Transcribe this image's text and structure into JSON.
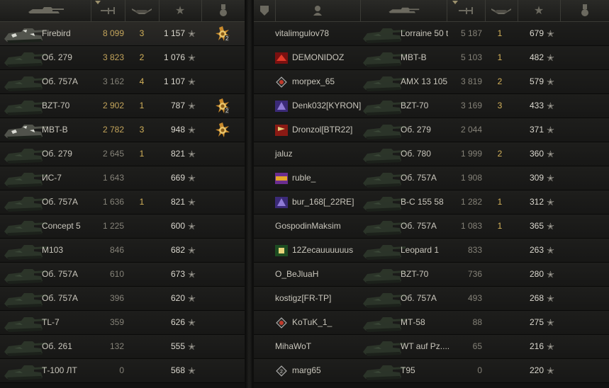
{
  "left_team": [
    {
      "tank": "Firebird",
      "battles": "8 099",
      "wins": "3",
      "score": "1 157",
      "medal": true,
      "medal_count": "2",
      "gold": true,
      "highlight": true
    },
    {
      "tank": "Об. 279",
      "battles": "3 823",
      "wins": "2",
      "score": "1 076",
      "gold": true
    },
    {
      "tank": "Об. 757А",
      "battles": "3 162",
      "wins": "4",
      "score": "1 107"
    },
    {
      "tank": "BZT-70",
      "battles": "2 902",
      "wins": "1",
      "score": "787",
      "medal": true,
      "medal_count": "2",
      "gold": true
    },
    {
      "tank": "MBT-B",
      "battles": "2 782",
      "wins": "3",
      "score": "948",
      "medal": true,
      "medal_count": "",
      "gold": true
    },
    {
      "tank": "Об. 279",
      "battles": "2 645",
      "wins": "1",
      "score": "821"
    },
    {
      "tank": "ИС-7",
      "battles": "1 643",
      "wins": "",
      "score": "669"
    },
    {
      "tank": "Об. 757А",
      "battles": "1 636",
      "wins": "1",
      "score": "821"
    },
    {
      "tank": "Concept 5",
      "battles": "1 225",
      "wins": "",
      "score": "600"
    },
    {
      "tank": "M103",
      "battles": "846",
      "wins": "",
      "score": "682"
    },
    {
      "tank": "Об. 757А",
      "battles": "610",
      "wins": "",
      "score": "673"
    },
    {
      "tank": "Об. 757А",
      "battles": "396",
      "wins": "",
      "score": "620"
    },
    {
      "tank": "TL-7",
      "battles": "359",
      "wins": "",
      "score": "626"
    },
    {
      "tank": "Об. 261",
      "battles": "132",
      "wins": "",
      "score": "555"
    },
    {
      "tank": "Т-100 ЛТ",
      "battles": "0",
      "wins": "",
      "score": "568"
    }
  ],
  "right_team": [
    {
      "player": "vitalimgulov78",
      "clan_icon": "",
      "tank": "Lorraine 50 t",
      "battles": "5 187",
      "wins": "1",
      "score": "679"
    },
    {
      "player": "DEMONIDOZ",
      "clan_icon": "red",
      "tank": "MBT-B",
      "battles": "5 103",
      "wins": "1",
      "score": "482"
    },
    {
      "player": "morpex_65",
      "clan_icon": "diamond-red",
      "tank": "AMX 13 105",
      "battles": "3 819",
      "wins": "2",
      "score": "579"
    },
    {
      "player": "Denk032[KYRON]",
      "clan_icon": "purple",
      "tank": "BZT-70",
      "battles": "3 169",
      "wins": "3",
      "score": "433"
    },
    {
      "player": "Dronzol[BTR22]",
      "clan_icon": "red-flag",
      "tank": "Об. 279",
      "battles": "2 044",
      "wins": "",
      "score": "371"
    },
    {
      "player": "jaluz",
      "clan_icon": "",
      "tank": "Об. 780",
      "battles": "1 999",
      "wins": "2",
      "score": "360"
    },
    {
      "player": "ruble_",
      "clan_icon": "legend",
      "tank": "Об. 757А",
      "battles": "1 908",
      "wins": "",
      "score": "309"
    },
    {
      "player": "bur_168[_22RE]",
      "clan_icon": "purple",
      "tank": "В-С 155 58",
      "battles": "1 282",
      "wins": "1",
      "score": "312"
    },
    {
      "player": "GospodinMaksim",
      "clan_icon": "",
      "tank": "Об. 757А",
      "battles": "1 083",
      "wins": "1",
      "score": "365"
    },
    {
      "player": "12Zecauuuuuus",
      "clan_icon": "green",
      "tank": "Leopard 1",
      "battles": "833",
      "wins": "",
      "score": "263"
    },
    {
      "player": "O_BeJluaH",
      "clan_icon": "",
      "tank": "BZT-70",
      "battles": "736",
      "wins": "",
      "score": "280"
    },
    {
      "player": "kostigz[FR-TP]",
      "clan_icon": "",
      "tank": "Об. 757А",
      "battles": "493",
      "wins": "",
      "score": "268"
    },
    {
      "player": "KoTuK_1_",
      "clan_icon": "diamond-red",
      "tank": "МТ-58",
      "battles": "88",
      "wins": "",
      "score": "275"
    },
    {
      "player": "MihaWoT",
      "clan_icon": "",
      "tank": "WT auf Pz....",
      "battles": "65",
      "wins": "",
      "score": "216"
    },
    {
      "player": "marg65",
      "clan_icon": "diamond-grey",
      "tank": "T95",
      "battles": "0",
      "wins": "",
      "score": "220"
    }
  ],
  "star_glyph": "✭"
}
